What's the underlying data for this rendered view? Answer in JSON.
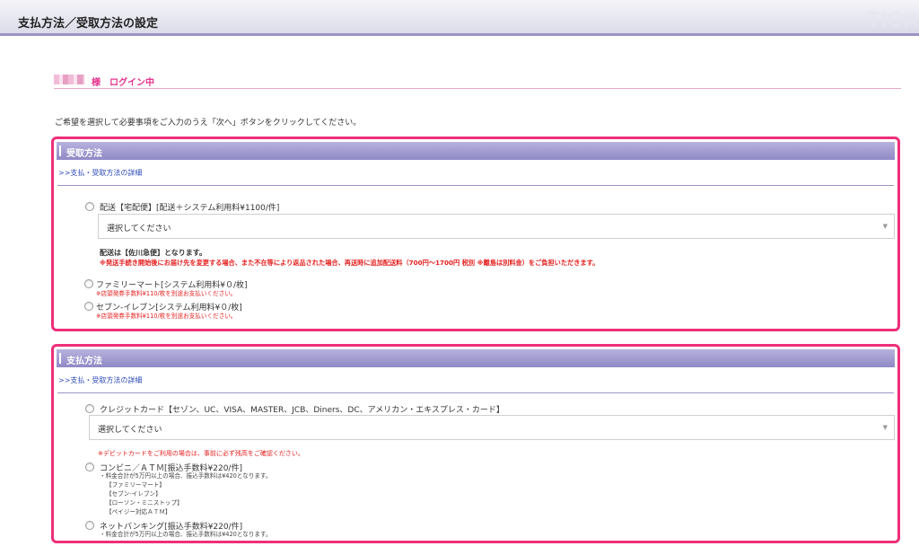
{
  "page": {
    "title": "支払方法／受取方法の設定",
    "logo": "TICK"
  },
  "login": {
    "status": "様　ログイン中"
  },
  "intro": "ご希望を選択して必要事項をご入力のうえ「次へ」ボタンをクリックしてください。",
  "receive": {
    "header": "受取方法",
    "detail_link": ">>支払・受取方法の詳細",
    "delivery": {
      "label": "配送【宅配便】[配送＋システム利用料¥1100/件]",
      "select_value": "選択してください",
      "note": "配送は【佐川急便】となります。",
      "warning": "※発送手続き開始後にお届け先を変更する場合、また不在等により返品された場合、再送時に追加配送料（700円〜1700円 税別 ※離島は別料金）をご負担いただきます。"
    },
    "familymart": {
      "label": "ファミリーマート[システム利用料¥０/枚]",
      "fee": "※店頭発券手数料¥110/枚を別途お支払いください。"
    },
    "seven": {
      "label": "セブン-イレブン[システム利用料¥０/枚]",
      "fee": "※店頭発券手数料¥110/枚を別途お支払いください。"
    }
  },
  "pay": {
    "header": "支払方法",
    "detail_link": ">>支払・受取方法の詳細",
    "credit": {
      "label": "クレジットカード【セゾン、UC、VISA、MASTER、JCB、Diners、DC、アメリカン・エキスプレス・カード】",
      "select_value": "選択してください",
      "warning": "※デビットカードをご利用の場合は、事前に必ず残高をご確認ください。"
    },
    "cvs": {
      "label": "コンビニ／ＡＴＭ[振込手数料¥220/件]",
      "notes": [
        "・料金合計が5万円以上の場合、振込手数料は¥420となります。",
        "【ファミリーマート】",
        "【セブン-イレブン】",
        "【ローソン・ミニストップ】",
        "【ペイジー対応ＡＴＭ】"
      ]
    },
    "netbank": {
      "label": "ネットバンキング[振込手数料¥220/件]",
      "note": "・料金合計が5万円以上の場合、振込手数料は¥420となります。"
    }
  },
  "colors": {
    "accent_pink": "#ee2f79",
    "header_purple": "#8f89c6",
    "link_blue": "#2f4bb8",
    "warning_red": "#e51e1e"
  }
}
